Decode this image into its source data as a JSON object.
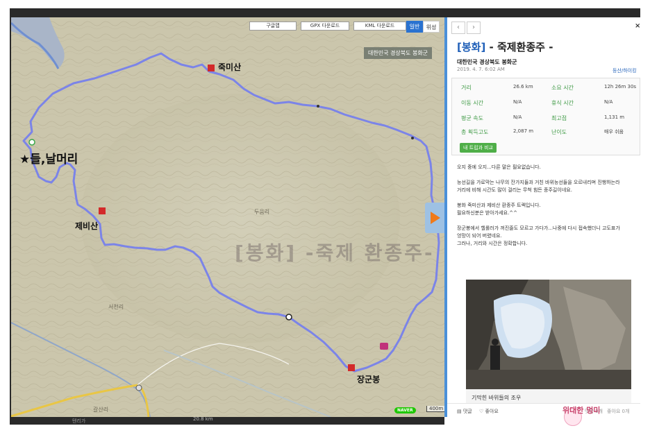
{
  "map": {
    "buttons": {
      "road": "구글맵",
      "gpx": "GPX 다운로드",
      "kml": "KML 다운로드"
    },
    "type_toggle": {
      "normal": "일반",
      "satellite": "위성"
    },
    "region_tag": "대한민국 경상북도 봉화군",
    "peaks": {
      "jukmi": "죽미산",
      "jebi": "제비산",
      "janggun": "장군봉",
      "start": "★들,날머리"
    },
    "villages": {
      "dueum": "두음리",
      "seocheon": "서천리",
      "galsan": "갈산리"
    },
    "watermark": "[봉화] -죽제 환종주-",
    "provider": "NAVER",
    "scale": "400m",
    "bottom_hint": "텐리가",
    "scale_hint": "20.8 km",
    "colors": {
      "route": "#7b84e8",
      "accent": "#f07a1a"
    }
  },
  "panel": {
    "nav": {
      "prev": "‹",
      "next": "›",
      "close": "×"
    },
    "title_prefix": "[봉화]",
    "title_rest": " - 죽제환종주 -",
    "location": "대한민국 경상북도 봉화군",
    "date": "2019. 4. 7. 6:02 AM",
    "category": "등산/하이킹",
    "stats": [
      {
        "label": "거리",
        "value": "26.6 km",
        "label2": "소요 시간",
        "value2": "12h 26m 30s"
      },
      {
        "label": "이동 시간",
        "value": "N/A",
        "label2": "휴식 시간",
        "value2": "N/A"
      },
      {
        "label": "평균 속도",
        "value": "N/A",
        "label2": "최고점",
        "value2": "1,131 m"
      },
      {
        "label": "총 획득고도",
        "value": "2,087 m",
        "label2": "난이도",
        "value2": "매우 쉬움"
      }
    ],
    "compare_label": "내 트립과 비교",
    "description": [
      "오지 중에 오지...다른 말은 필요없습니다.",
      "",
      "능선길을 가로막는 나무의 잔가지들과 거친 바위능선들을 오르내리며 진행하는라",
      "거리에 비해 시간도 많이 걸리는 무척 힘든 종주길이네요.",
      "",
      "봉화 죽미산과 제비산 환종주 트렉입니다.",
      "필요하신분은 받아가세요.^^",
      "",
      "장군봉에서 헬롤러가 꺼진줄도 모르고 가다가...나중에 다시 접속했더니 고도표가",
      "엉망이 되어 버렸네요.",
      "그러나, 거리와 시간은 정확합니다."
    ],
    "photo_caption": "기막힌 바위들의 조우",
    "footer": {
      "comment": "댓글",
      "like": "좋아요",
      "comment_count": "댓글 0개",
      "like_count": "좋아요 0개"
    }
  },
  "blog_badge": "위대한 멍미"
}
